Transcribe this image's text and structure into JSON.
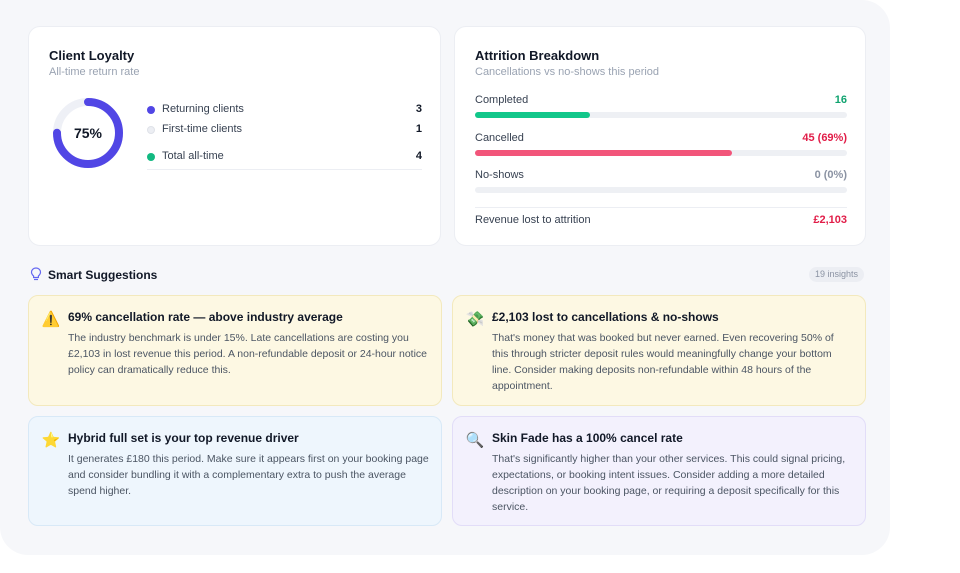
{
  "loyalty": {
    "title": "Client Loyalty",
    "subtitle": "All-time return rate",
    "percent_label": "75%",
    "percent": 75,
    "ring_color": "#5146e5",
    "ring_track_color": "#eef0f6",
    "legend": [
      {
        "label": "Returning clients",
        "value": "3",
        "color": "#5146e5"
      },
      {
        "label": "First-time clients",
        "value": "1",
        "color": "#eceef3"
      },
      {
        "label": "Total all-time",
        "value": "4",
        "color": "#12b981"
      }
    ]
  },
  "attrition": {
    "title": "Attrition Breakdown",
    "subtitle": "Cancellations vs no-shows this period",
    "rows": [
      {
        "label": "Completed",
        "value": "16",
        "fraction": 0.31,
        "color": "#12c78a",
        "value_color": "#10a36f"
      },
      {
        "label": "Cancelled",
        "value": "45 (69%)",
        "fraction": 0.69,
        "color": "#f2557a",
        "value_color": "#e11d48"
      },
      {
        "label": "No-shows",
        "value": "0 (0%)",
        "fraction": 0.0,
        "color": "#9aa3b2",
        "value_color": "#8b93a3"
      }
    ],
    "revenue_label": "Revenue lost to attrition",
    "revenue_value": "£2,103",
    "revenue_color": "#e11d48"
  },
  "suggestions": {
    "title": "Smart Suggestions",
    "badge": "19 insights",
    "header_icon": "lightbulb-icon",
    "items": [
      {
        "icon": "warning-icon",
        "glyph": "⚠️",
        "title": "69% cancellation rate — above industry average",
        "body": "The industry benchmark is under 15%. Late cancellations are costing you £2,103 in lost revenue this period. A non-refundable deposit or 24-hour notice policy can dramatically reduce this."
      },
      {
        "icon": "money-wings-icon",
        "glyph": "💸",
        "title": "£2,103 lost to cancellations & no-shows",
        "body": "That's money that was booked but never earned. Even recovering 50% of this through stricter deposit rules would meaningfully change your bottom line. Consider making deposits non-refundable within 48 hours of the appointment."
      },
      {
        "icon": "star-icon",
        "glyph": "⭐",
        "title": "Hybrid full set is your top revenue driver",
        "body": "It generates £180 this period. Make sure it appears first on your booking page and consider bundling it with a complementary extra to push the average spend higher."
      },
      {
        "icon": "magnifier-icon",
        "glyph": "🔍",
        "title": "Skin Fade has a 100% cancel rate",
        "body": "That's significantly higher than your other services. This could signal pricing, expectations, or booking intent issues. Consider adding a more detailed description on your booking page, or requiring a deposit specifically for this service."
      }
    ]
  }
}
